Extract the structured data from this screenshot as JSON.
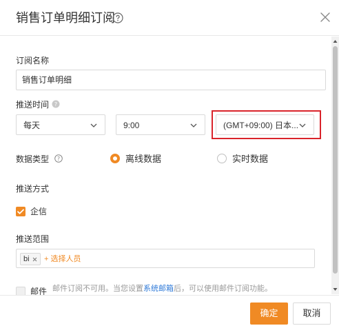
{
  "dialog": {
    "title": "销售订单明细订阅"
  },
  "form": {
    "name_label": "订阅名称",
    "name_value": "销售订单明细",
    "push_time_label": "推送时间",
    "frequency": "每天",
    "time": "9:00",
    "timezone": "(GMT+09:00) 日本...",
    "data_type_label": "数据类型",
    "data_type_options": [
      "离线数据",
      "实时数据"
    ],
    "data_type_selected": "离线数据",
    "push_method_label": "推送方式",
    "wecom_label": "企信",
    "wecom_checked": true,
    "push_range_label": "推送范围",
    "range_tag": "bi",
    "add_person": "+ 选择人员",
    "mail_label": "邮件",
    "mail_checked": false,
    "mail_note_before": "邮件订阅不可用。当您设置",
    "mail_note_link": "系统邮箱",
    "mail_note_after": "后，可以使用邮件订阅功能。"
  },
  "footer": {
    "ok_label": "确定",
    "cancel_label": "取消"
  },
  "colors": {
    "accent": "#f08a24",
    "highlight": "#d9232a",
    "link": "#2f7ad8"
  }
}
